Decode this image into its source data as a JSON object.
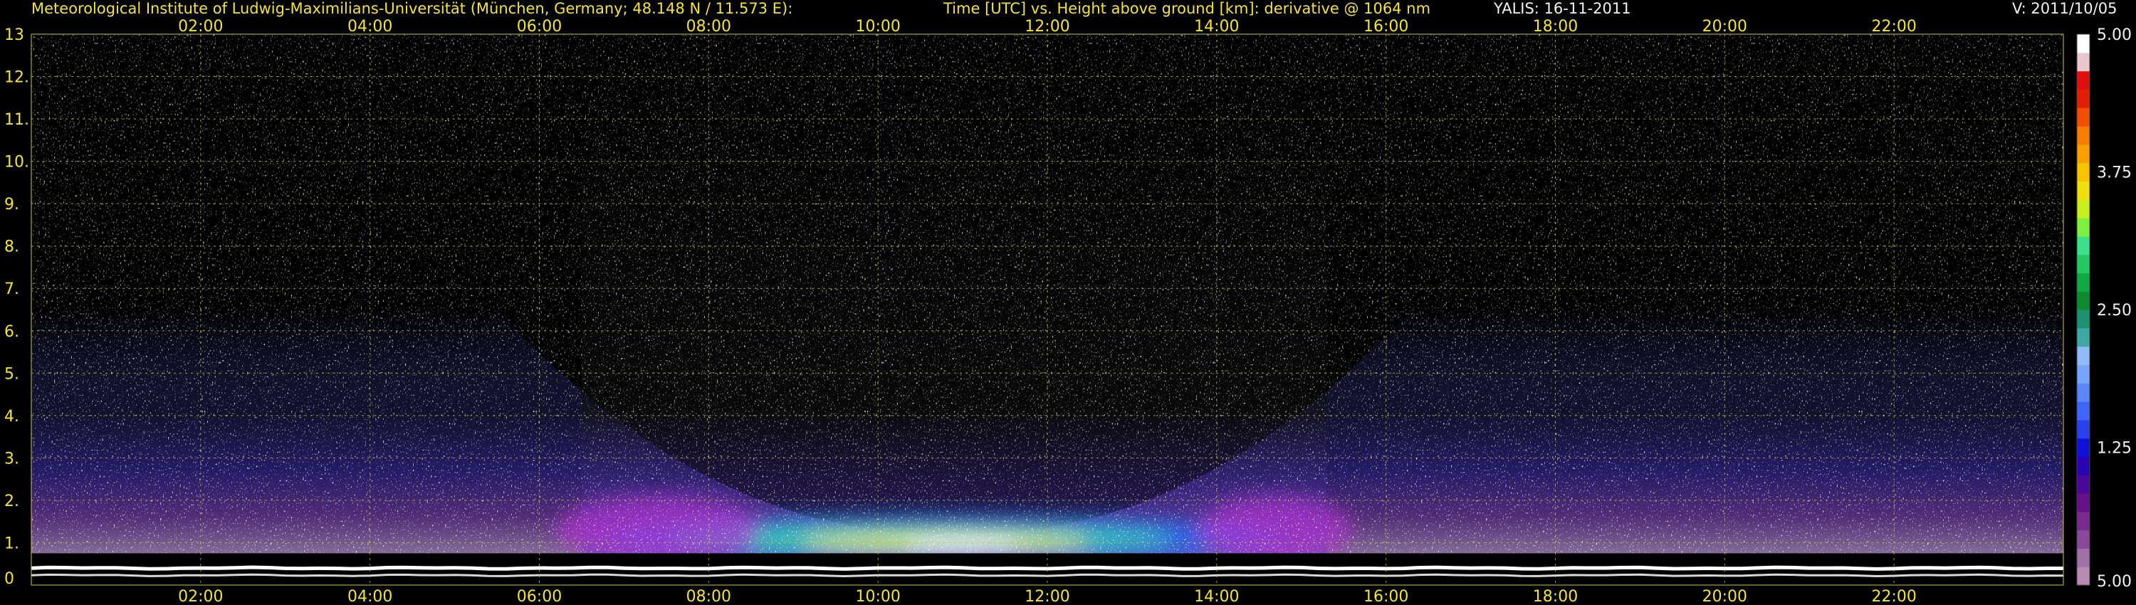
{
  "header": {
    "institute": "Meteorological Institute of Ludwig-Maximilians-Universität (München, Germany; 48.148 N / 11.573 E):",
    "description": "Time [UTC] vs. Height above ground [km]: derivative @ 1064 nm",
    "instrument_date": "YALIS: 16-11-2011",
    "version": "V: 2011/10/05"
  },
  "colors": {
    "label_text": "#f3e33a",
    "white_text": "#f2f2f2",
    "grid": "#c8c832",
    "background": "#000000",
    "colorbar": [
      "#b98ab4",
      "#a070a8",
      "#8a4a9a",
      "#7a2a8c",
      "#66118a",
      "#4a0896",
      "#2a04b4",
      "#1010d8",
      "#2840ee",
      "#3f66f6",
      "#5a88fa",
      "#78a4fa",
      "#92baf8",
      "#3ea8a4",
      "#1f9070",
      "#0f8a30",
      "#10a840",
      "#24c860",
      "#3ce08a",
      "#80f040",
      "#c8f020",
      "#f0e010",
      "#f8c400",
      "#f8a000",
      "#f87c00",
      "#f05000",
      "#e02000",
      "#e01010",
      "#e8c8d0",
      "#ffffff"
    ]
  },
  "chart_data": {
    "type": "heatmap",
    "title": "Time [UTC] vs. Height above ground [km]: derivative @ 1064 nm",
    "xlabel": "Time [UTC]",
    "ylabel": "Height above ground [km]",
    "x_ticks": [
      "02:00",
      "04:00",
      "06:00",
      "08:00",
      "10:00",
      "12:00",
      "14:00",
      "16:00",
      "18:00",
      "20:00",
      "22:00"
    ],
    "y_ticks": [
      "0",
      "1.",
      "2.",
      "3.",
      "4.",
      "5.",
      "6.",
      "7.",
      "8.",
      "9.",
      "10.",
      "11.",
      "12.",
      "13"
    ],
    "x_range_hours": [
      0,
      24
    ],
    "ylim": [
      0,
      13
    ],
    "grid": true,
    "colorbar": {
      "labels": [
        "5.00",
        "3.75",
        "2.50",
        "1.25",
        "5.00"
      ],
      "range": [
        1.25,
        5.0
      ]
    },
    "features": {
      "residual_layer_top_km_night": 3.0,
      "boundary_layer_top_km_midday": 1.5,
      "aerosol_layer_km_midday": [
        0.8,
        1.4
      ],
      "day_start_utc_hours": 6.5,
      "day_end_utc_hours": 15.3,
      "ground_signal_km": [
        0.2,
        0.4
      ]
    }
  }
}
